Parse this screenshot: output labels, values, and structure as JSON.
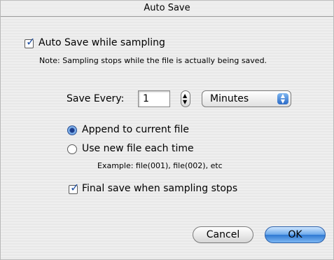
{
  "dialog": {
    "title": "Auto Save",
    "auto_save_label": "Auto Save while sampling",
    "note": "Note: Sampling stops while the file is actually being saved.",
    "save_every_label": "Save Every:",
    "save_every_value": "1",
    "units_value": "Minutes",
    "append_label": "Append to current file",
    "new_file_label": "Use new file each time",
    "example": "Example: file(001), file(002), etc",
    "final_save_label": "Final save when sampling stops",
    "cancel_label": "Cancel",
    "ok_label": "OK"
  }
}
